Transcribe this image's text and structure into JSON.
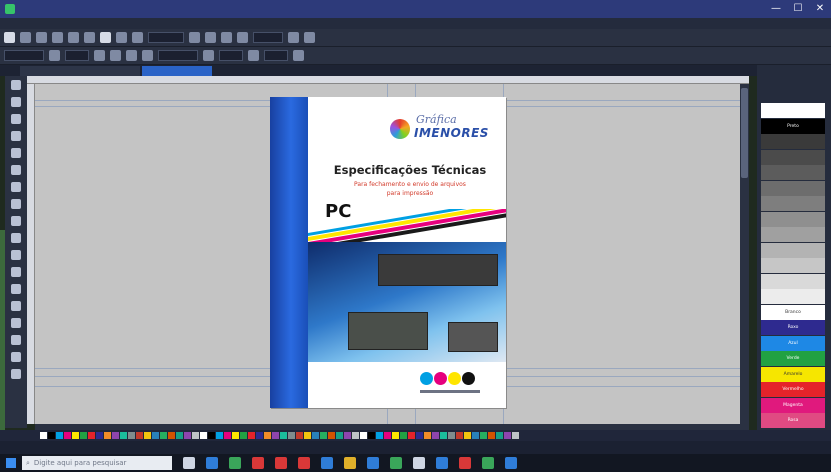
{
  "window": {
    "title": "",
    "minimize": "—",
    "maximize": "☐",
    "close": "✕"
  },
  "menu": [],
  "toolbar": {
    "zoom": "",
    "unit": ""
  },
  "tabs": [
    {
      "label": ""
    },
    {
      "label": ""
    }
  ],
  "document": {
    "brand_top": "Gráfica",
    "brand_bottom": "IMENORES",
    "title": "Especificações Técnicas",
    "subtitle_line1": "Para fechamento e envio de arquivos",
    "subtitle_line2": "para impressão",
    "platform": "PC"
  },
  "palette": {
    "swatches": [
      {
        "label": "",
        "color": "#ffffff"
      },
      {
        "label": "Preto",
        "color": "#000000"
      },
      {
        "label": "",
        "color": "#3a3a3a"
      },
      {
        "label": "",
        "color": "#4b4b4b"
      },
      {
        "label": "",
        "color": "#5c5c5c"
      },
      {
        "label": "",
        "color": "#6d6d6d"
      },
      {
        "label": "",
        "color": "#7e7e7e"
      },
      {
        "label": "",
        "color": "#8f8f8f"
      },
      {
        "label": "",
        "color": "#a0a0a0"
      },
      {
        "label": "",
        "color": "#b3b3b3"
      },
      {
        "label": "",
        "color": "#c6c6c6"
      },
      {
        "label": "",
        "color": "#d9d9d9"
      },
      {
        "label": "",
        "color": "#ececec"
      },
      {
        "label": "Branco",
        "color": "#ffffff"
      },
      {
        "label": "Roxo",
        "color": "#2e2a8f"
      },
      {
        "label": "Azul",
        "color": "#1e88e5"
      },
      {
        "label": "Verde",
        "color": "#21a143"
      },
      {
        "label": "Amarelo",
        "color": "#f6e600"
      },
      {
        "label": "Vermelho",
        "color": "#e5232a"
      },
      {
        "label": "Magenta",
        "color": "#e0197d"
      },
      {
        "label": "Rosa",
        "color": "#e04a82"
      }
    ]
  },
  "statusbar": {
    "left": "",
    "right": ""
  },
  "taskbar": {
    "search_placeholder": "Digite aqui para pesquisar",
    "time": "",
    "date": ""
  },
  "colors": {
    "accent": "#2a63c7",
    "titlebar": "#2d3a7a",
    "canvas": "#c4c4c4",
    "cyan": "#00a0e3",
    "magenta": "#e6007e",
    "yellow": "#ffe500",
    "black": "#111111"
  }
}
